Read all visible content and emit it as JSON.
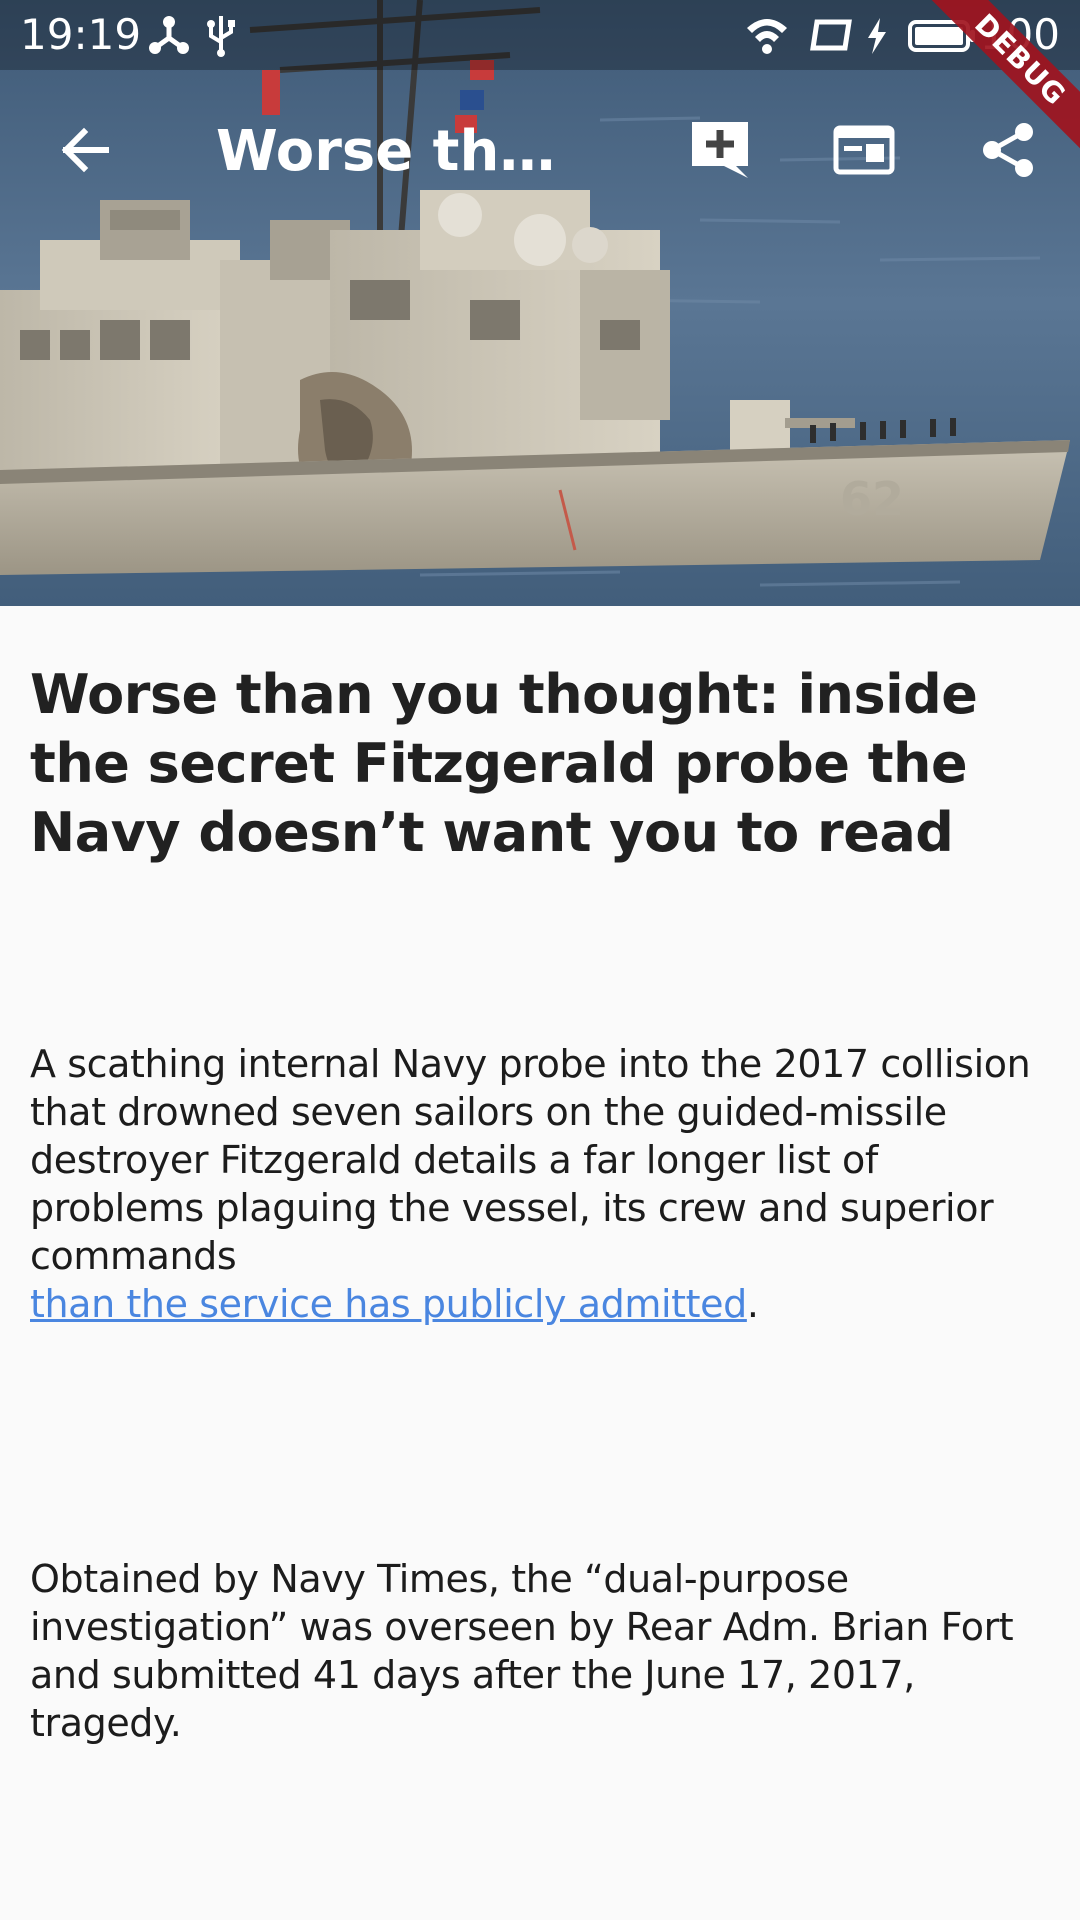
{
  "status_bar": {
    "time": "19:19",
    "battery_percent": "100",
    "icons": [
      "share-network-icon",
      "usb-icon",
      "wifi-icon",
      "screen-rotation-icon",
      "charging-bolt-icon",
      "battery-icon"
    ]
  },
  "debug_banner": {
    "label": "DEBUG",
    "color": "#a0141e"
  },
  "app_bar": {
    "title": "Worse than you thought: inside the secret Fitzgerald probe the Navy doesn’t want you to read",
    "actions": [
      "back-arrow-icon",
      "add-comment-icon",
      "reader-view-icon",
      "share-icon"
    ]
  },
  "hero_image": {
    "subject": "hero-ship-image"
  },
  "article": {
    "title": "Worse than you thought: inside the secret Fitzgerald probe the Navy doesn’t want you to read",
    "paragraph1_text": " A scathing internal Navy probe into the 2017 collision that drowned seven sailors on the guided-missile destroyer Fitzgerald details a far longer list of problems plaguing the vessel, its crew and superior commands",
    "paragraph1_link": "than the service has publicly admitted",
    "paragraph1_end": ".",
    "paragraph2_text": " Obtained by Navy Times, the “dual-purpose investigation” was overseen by Rear Adm. Brian Fort and submitted 41 days after the June 17, 2017, tragedy."
  },
  "colors": {
    "background": "#fafafa",
    "text": "#212121",
    "link": "#4a86e0"
  }
}
